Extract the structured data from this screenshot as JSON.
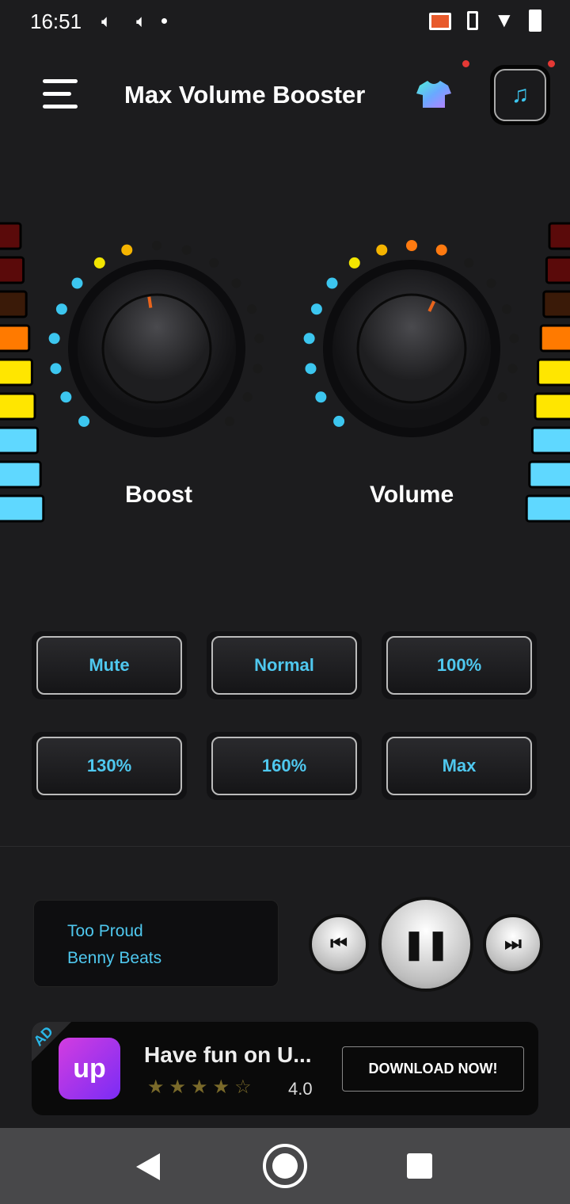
{
  "status": {
    "time": "16:51",
    "icons": [
      "volume-icon",
      "volume-icon",
      "dot-icon",
      "cast-icon",
      "vibrate-icon",
      "wifi-icon",
      "battery-icon"
    ]
  },
  "header": {
    "title": "Max Volume Booster",
    "icons": [
      "menu-icon",
      "shirt-icon",
      "music-note-icon"
    ],
    "music_glyph": "♫"
  },
  "knobs": [
    {
      "label": "Boost",
      "total_dots": 17,
      "lit_dots": 8
    },
    {
      "label": "Volume",
      "total_dots": 17,
      "lit_dots": 10
    }
  ],
  "meters": {
    "segments": 9,
    "lit": 6,
    "colors": [
      "#5a0a0a",
      "#5a0a0a",
      "#3a1a08",
      "#ff7a00",
      "#ffe600",
      "#ffe600",
      "#5fd8ff",
      "#5fd8ff",
      "#5fd8ff"
    ]
  },
  "presets": [
    "Mute",
    "Normal",
    "100%",
    "130%",
    "160%",
    "Max"
  ],
  "player": {
    "track": "Too Proud",
    "artist": "Benny Beats",
    "prev": "⏮",
    "pause": "❚❚",
    "next": "⏭"
  },
  "ad": {
    "tag": "AD",
    "logo": "up",
    "title": "Have fun on U...",
    "stars": "★★★★☆",
    "rating": "4.0",
    "cta": "DOWNLOAD NOW!"
  },
  "colors": {
    "accent": "#4fc8ef",
    "background": "#1c1c1e"
  }
}
